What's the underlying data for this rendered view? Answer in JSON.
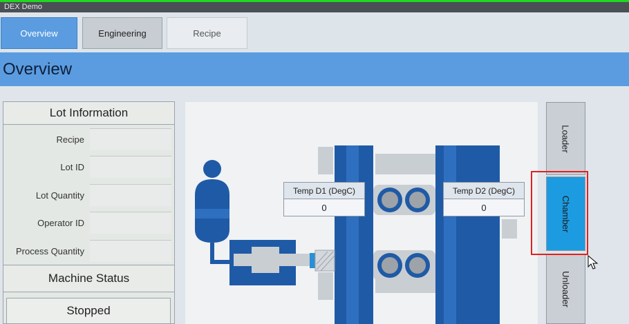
{
  "window": {
    "title": "DEX Demo"
  },
  "tabs": [
    {
      "label": "Overview",
      "active": true
    },
    {
      "label": "Engineering",
      "active": false
    },
    {
      "label": "Recipe",
      "active": false
    }
  ],
  "page": {
    "title": "Overview"
  },
  "lot_info": {
    "header": "Lot Information",
    "fields": [
      {
        "label": "Recipe",
        "value": ""
      },
      {
        "label": "Lot ID",
        "value": ""
      },
      {
        "label": "Lot Quantity",
        "value": ""
      },
      {
        "label": "Operator ID",
        "value": ""
      },
      {
        "label": "Process Quantity",
        "value": ""
      }
    ]
  },
  "machine": {
    "header": "Machine Status",
    "status": "Stopped"
  },
  "temps": {
    "d1": {
      "label": "Temp D1 (DegC)",
      "value": "0"
    },
    "d2": {
      "label": "Temp D2 (DegC)",
      "value": "0"
    }
  },
  "side_buttons": {
    "loader": "Loader",
    "chamber": "Chamber",
    "unloader": "Unloader",
    "selected": "chamber"
  },
  "colors": {
    "accent": "#5b9ce0",
    "machine_blue": "#1f5aa6",
    "selected_button": "#1c9be0",
    "highlight": "#e02020",
    "title_bar_accent": "#1fd81f"
  }
}
